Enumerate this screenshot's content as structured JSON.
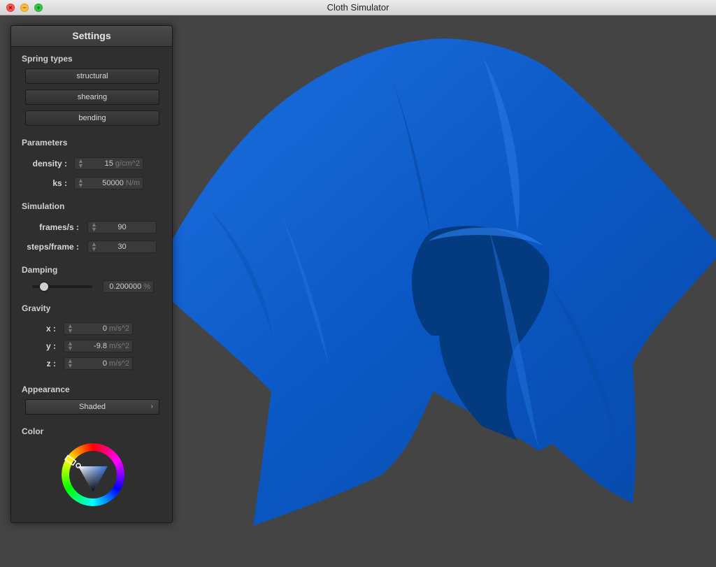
{
  "window": {
    "title": "Cloth Simulator"
  },
  "cloth_color": "#0a5ac8",
  "panel": {
    "title": "Settings",
    "spring_types": {
      "heading": "Spring types",
      "buttons": [
        "structural",
        "shearing",
        "bending"
      ]
    },
    "parameters": {
      "heading": "Parameters",
      "density": {
        "label": "density :",
        "value": "15",
        "unit": "g/cm^2"
      },
      "ks": {
        "label": "ks :",
        "value": "50000",
        "unit": "N/m"
      }
    },
    "simulation": {
      "heading": "Simulation",
      "frames": {
        "label": "frames/s :",
        "value": "90"
      },
      "steps": {
        "label": "steps/frame :",
        "value": "30"
      }
    },
    "damping": {
      "heading": "Damping",
      "value": "0.200000",
      "unit": "%",
      "slider_fraction": 0.2
    },
    "gravity": {
      "heading": "Gravity",
      "x": {
        "label": "x :",
        "value": "0",
        "unit": "m/s^2"
      },
      "y": {
        "label": "y :",
        "value": "-9.8",
        "unit": "m/s^2"
      },
      "z": {
        "label": "z :",
        "value": "0",
        "unit": "m/s^2"
      }
    },
    "appearance": {
      "heading": "Appearance",
      "selected": "Shaded",
      "chevron": "›"
    },
    "color": {
      "heading": "Color",
      "selected_hue_color": "#ffffff"
    }
  }
}
